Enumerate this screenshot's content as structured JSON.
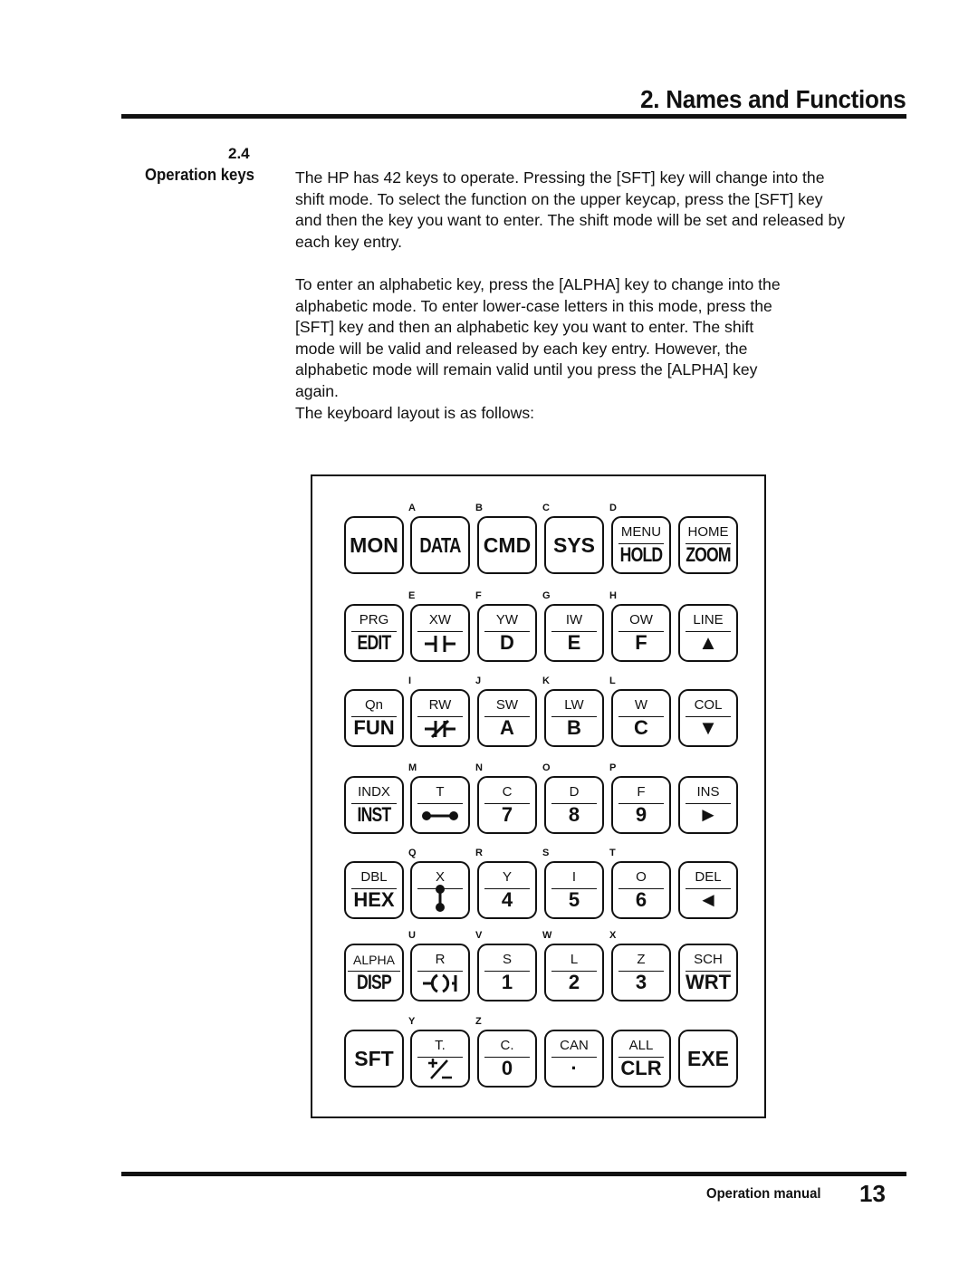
{
  "header": {
    "chapter_title": "2. Names and Functions"
  },
  "section": {
    "number": "2.4",
    "label": "Operation keys",
    "paragraphs": [
      "The HP has 42 keys to operate. Pressing the [SFT] key will change into the shift mode. To select the function on the upper keycap, press the [SFT] key and then the key you want to enter. The shift mode will be set and released by each key entry.",
      "To enter an alphabetic key, press the [ALPHA] key to change into the alphabetic mode. To enter lower-case letters in this mode, press the [SFT] key and then an alphabetic key you want to enter. The shift mode will be valid and released by each key entry. However, the alphabetic mode will remain valid until you press the [ALPHA] key again.",
      "The keyboard layout is as follows:"
    ]
  },
  "keyboard": {
    "rows": [
      [
        {
          "upper": "",
          "lower": "MON",
          "alpha": "",
          "icon": ""
        },
        {
          "upper": "",
          "lower": "DATA",
          "alpha": "A",
          "icon": ""
        },
        {
          "upper": "",
          "lower": "CMD",
          "alpha": "B",
          "icon": ""
        },
        {
          "upper": "",
          "lower": "SYS",
          "alpha": "C",
          "icon": ""
        },
        {
          "upper": "MENU",
          "lower": "HOLD",
          "alpha": "D",
          "icon": ""
        },
        {
          "upper": "HOME",
          "lower": "ZOOM",
          "alpha": "",
          "icon": ""
        }
      ],
      [
        {
          "upper": "PRG",
          "lower": "EDIT",
          "alpha": "",
          "icon": ""
        },
        {
          "upper": "XW",
          "lower": "",
          "alpha": "E",
          "icon": "normally-open-contact"
        },
        {
          "upper": "YW",
          "lower": "D",
          "alpha": "F",
          "icon": ""
        },
        {
          "upper": "IW",
          "lower": "E",
          "alpha": "G",
          "icon": ""
        },
        {
          "upper": "OW",
          "lower": "F",
          "alpha": "H",
          "icon": ""
        },
        {
          "upper": "LINE",
          "lower": "▲",
          "alpha": "",
          "icon": "up-arrow"
        }
      ],
      [
        {
          "upper": "Qn",
          "lower": "FUN",
          "alpha": "",
          "icon": ""
        },
        {
          "upper": "RW",
          "lower": "",
          "alpha": "I",
          "icon": "normally-closed-contact"
        },
        {
          "upper": "SW",
          "lower": "A",
          "alpha": "J",
          "icon": ""
        },
        {
          "upper": "LW",
          "lower": "B",
          "alpha": "K",
          "icon": ""
        },
        {
          "upper": "W",
          "lower": "C",
          "alpha": "L",
          "icon": ""
        },
        {
          "upper": "COL",
          "lower": "▼",
          "alpha": "",
          "icon": "down-arrow"
        }
      ],
      [
        {
          "upper": "INDX",
          "lower": "INST",
          "alpha": "",
          "icon": ""
        },
        {
          "upper": "T",
          "lower": "",
          "alpha": "M",
          "icon": "horizontal-connection"
        },
        {
          "upper": "C",
          "lower": "7",
          "alpha": "N",
          "icon": ""
        },
        {
          "upper": "D",
          "lower": "8",
          "alpha": "O",
          "icon": ""
        },
        {
          "upper": "F",
          "lower": "9",
          "alpha": "P",
          "icon": ""
        },
        {
          "upper": "INS",
          "lower": "►",
          "alpha": "",
          "icon": "right-arrow"
        }
      ],
      [
        {
          "upper": "DBL",
          "lower": "HEX",
          "alpha": "",
          "icon": ""
        },
        {
          "upper": "X",
          "lower": "",
          "alpha": "Q",
          "icon": "vertical-connection"
        },
        {
          "upper": "Y",
          "lower": "4",
          "alpha": "R",
          "icon": ""
        },
        {
          "upper": "I",
          "lower": "5",
          "alpha": "S",
          "icon": ""
        },
        {
          "upper": "O",
          "lower": "6",
          "alpha": "T",
          "icon": ""
        },
        {
          "upper": "DEL",
          "lower": "◄",
          "alpha": "",
          "icon": "left-arrow"
        }
      ],
      [
        {
          "upper": "ALPHA",
          "lower": "DISP",
          "alpha": "",
          "icon": ""
        },
        {
          "upper": "R",
          "lower": "",
          "alpha": "U",
          "icon": "coil"
        },
        {
          "upper": "S",
          "lower": "1",
          "alpha": "V",
          "icon": ""
        },
        {
          "upper": "L",
          "lower": "2",
          "alpha": "W",
          "icon": ""
        },
        {
          "upper": "Z",
          "lower": "3",
          "alpha": "X",
          "icon": ""
        },
        {
          "upper": "SCH",
          "lower": "WRT",
          "alpha": "",
          "icon": ""
        }
      ],
      [
        {
          "upper": "",
          "lower": "SFT",
          "alpha": "",
          "icon": ""
        },
        {
          "upper": "T.",
          "lower": "+/−",
          "alpha": "Y",
          "icon": "plus-minus"
        },
        {
          "upper": "C.",
          "lower": "0",
          "alpha": "Z",
          "icon": ""
        },
        {
          "upper": "CAN",
          "lower": "·",
          "alpha": "",
          "icon": ""
        },
        {
          "upper": "ALL",
          "lower": "CLR",
          "alpha": "",
          "icon": ""
        },
        {
          "upper": "",
          "lower": "EXE",
          "alpha": "",
          "icon": ""
        }
      ]
    ]
  },
  "footer": {
    "label": "Operation manual",
    "page_number": "13"
  }
}
